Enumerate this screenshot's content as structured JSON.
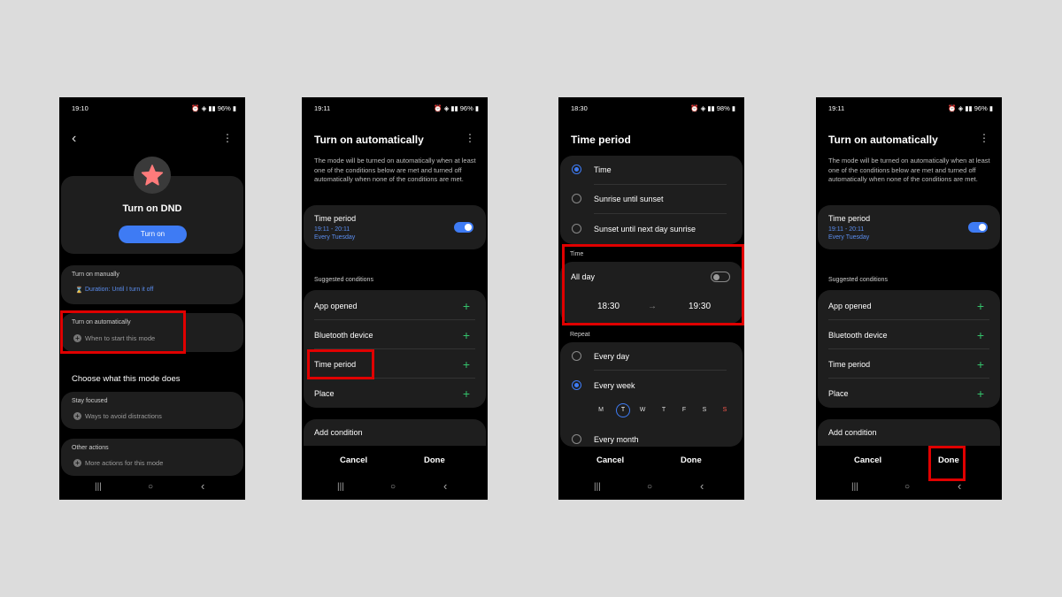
{
  "colors": {
    "accent": "#3e7bf4",
    "add": "#34c26b",
    "highlight": "#e00000",
    "background": "#dcdcdc"
  },
  "screen1": {
    "status_time": "19:10",
    "status_battery": "96%",
    "title": "Turn on DND",
    "turn_on_button": "Turn on",
    "manual_head": "Turn on manually",
    "manual_value": "Duration: Until I turn it off",
    "auto_head": "Turn on automatically",
    "auto_value": "When to start this mode",
    "section_title": "Choose what this mode does",
    "focused_head": "Stay focused",
    "focused_value": "Ways to avoid distractions",
    "other_head": "Other actions",
    "other_value": "More actions for this mode"
  },
  "screen2": {
    "status_time": "19:11",
    "status_battery": "96%",
    "title": "Turn on automatically",
    "description": "The mode will be turned on automatically when at least one of the conditions below are met and turned off automatically when none of the conditions are met.",
    "time_period_label": "Time period",
    "time_period_range": "19:11 - 20:11",
    "time_period_repeat": "Every Tuesday",
    "suggested_head": "Suggested conditions",
    "conditions": [
      "App opened",
      "Bluetooth device",
      "Time period",
      "Place"
    ],
    "add_condition": "Add condition",
    "cancel": "Cancel",
    "done": "Done"
  },
  "screen3": {
    "status_time": "18:30",
    "status_battery": "98%",
    "title": "Time period",
    "options": [
      "Time",
      "Sunrise until sunset",
      "Sunset until next day sunrise"
    ],
    "time_head": "Time",
    "all_day": "All day",
    "start_time": "18:30",
    "arrow": "→",
    "end_time": "19:30",
    "repeat_head": "Repeat",
    "repeat_options": [
      "Every day",
      "Every week",
      "Every month"
    ],
    "days": [
      "M",
      "T",
      "W",
      "T",
      "F",
      "S",
      "S"
    ],
    "cancel": "Cancel",
    "done": "Done"
  },
  "screen4": {
    "status_time": "19:11",
    "status_battery": "96%",
    "title": "Turn on automatically",
    "description": "The mode will be turned on automatically when at least one of the conditions below are met and turned off automatically when none of the conditions are met.",
    "time_period_label": "Time period",
    "time_period_range": "19:11 - 20:11",
    "time_period_repeat": "Every Tuesday",
    "suggested_head": "Suggested conditions",
    "conditions": [
      "App opened",
      "Bluetooth device",
      "Time period",
      "Place"
    ],
    "add_condition": "Add condition",
    "cancel": "Cancel",
    "done": "Done"
  },
  "nav": {
    "recents": "|||",
    "home": "○",
    "back": "‹"
  }
}
